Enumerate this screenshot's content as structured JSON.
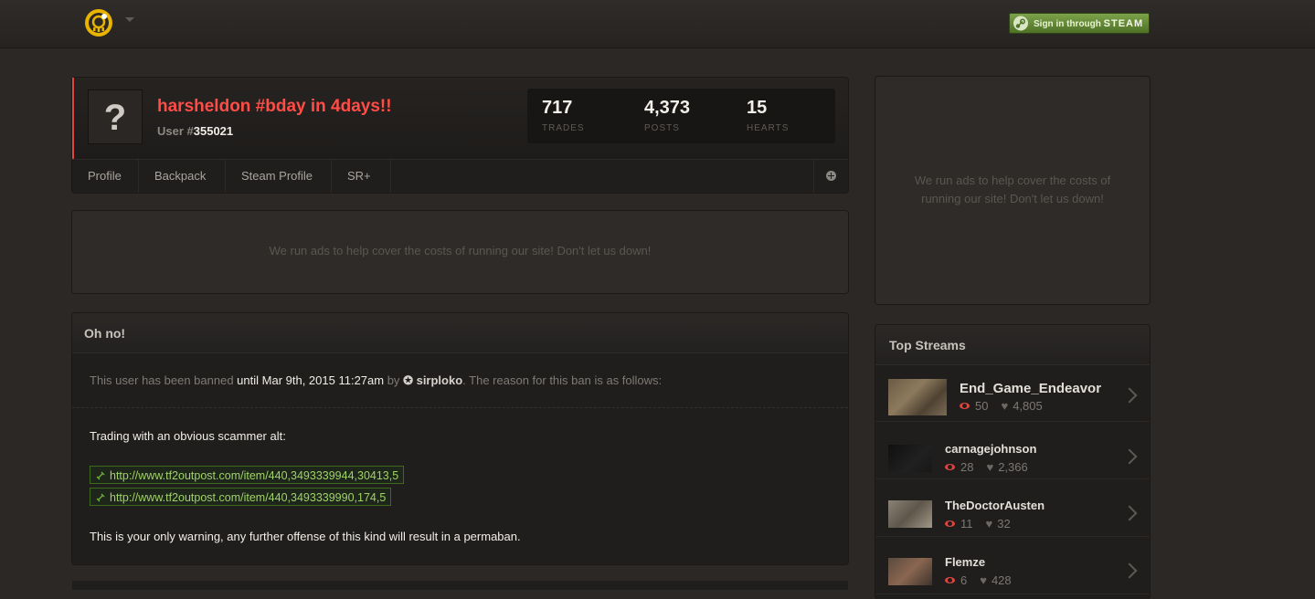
{
  "header": {
    "logo_icon": "backpack-tf-logo-icon",
    "steam_button": {
      "prefix": "Sign in through",
      "brand": "STEAM"
    }
  },
  "profile": {
    "avatar_glyph": "?",
    "username": "harsheldon #bday in 4days!!",
    "user_id_prefix": "User #",
    "user_id": "355021",
    "stats": [
      {
        "value": "717",
        "label": "TRADES"
      },
      {
        "value": "4,373",
        "label": "POSTS"
      },
      {
        "value": "15",
        "label": "HEARTS"
      }
    ],
    "tabs": [
      "Profile",
      "Backpack",
      "Steam Profile",
      "SR+"
    ]
  },
  "ads": {
    "main": "We run ads to help cover the costs of running our site! Don't let us down!",
    "side_line1": "We run ads to help cover the costs of",
    "side_line2": "running our site! Don't let us down!"
  },
  "ban": {
    "title": "Oh no!",
    "intro": "This user has been banned ",
    "until": "until Mar 9th, 2015 11:27am",
    "by": " by ",
    "moderator": "sirploko",
    "suffix": ". The reason for this ban is as follows:",
    "reason_line": "Trading with an obvious scammer alt:",
    "links": [
      "http://www.tf2outpost.com/item/440,3493339944,30413,5",
      "http://www.tf2outpost.com/item/440,3493339990,174,5"
    ],
    "warning": "This is your only warning, any further offense of this kind will result in a permaban."
  },
  "streams": {
    "title": "Top Streams",
    "items": [
      {
        "name": "End_Game_Endeavor",
        "viewers": "50",
        "hearts": "4,805"
      },
      {
        "name": "carnagejohnson",
        "viewers": "28",
        "hearts": "2,366"
      },
      {
        "name": "TheDoctorAusten",
        "viewers": "11",
        "hearts": "32"
      },
      {
        "name": "Flemze",
        "viewers": "6",
        "hearts": "428"
      }
    ]
  },
  "colors": {
    "accent_red": "#ff4c46",
    "link_green": "#9fd366",
    "steam_green": "#6a9340"
  }
}
